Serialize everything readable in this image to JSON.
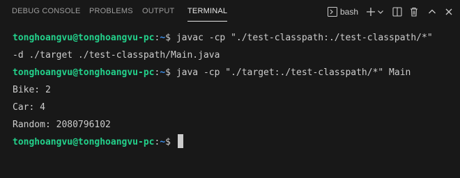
{
  "tabs": [
    {
      "label": "DEBUG CONSOLE",
      "active": false
    },
    {
      "label": "PROBLEMS",
      "active": false
    },
    {
      "label": "OUTPUT",
      "active": false
    },
    {
      "label": "TERMINAL",
      "active": true
    }
  ],
  "actions": {
    "shell_icon": "terminal-icon",
    "shell_label": "bash",
    "new_terminal_icon": "plus-icon",
    "dropdown_icon": "chevron-down-icon",
    "split_icon": "split-editor-icon",
    "kill_icon": "trash-icon",
    "maximize_icon": "chevron-up-icon",
    "close_icon": "close-icon"
  },
  "terminal": {
    "user_host": "tonghoangvu@tonghoangvu-pc",
    "colon": ":",
    "path": "~",
    "dollar": "$ ",
    "line1_cmd": "javac -cp \"./test-classpath:./test-classpath/*\"",
    "line2_text": "-d ./target ./test-classpath/Main.java",
    "line3_cmd": "java -cp \"./target:./test-classpath/*\" Main",
    "output_1": "Bike: 2",
    "output_2": "Car: 4",
    "output_3": "Random: 2080796102"
  },
  "colors": {
    "background": "#181818",
    "prompt_user": "#23d18b",
    "prompt_path": "#3b8eea",
    "text": "#cccccc"
  }
}
